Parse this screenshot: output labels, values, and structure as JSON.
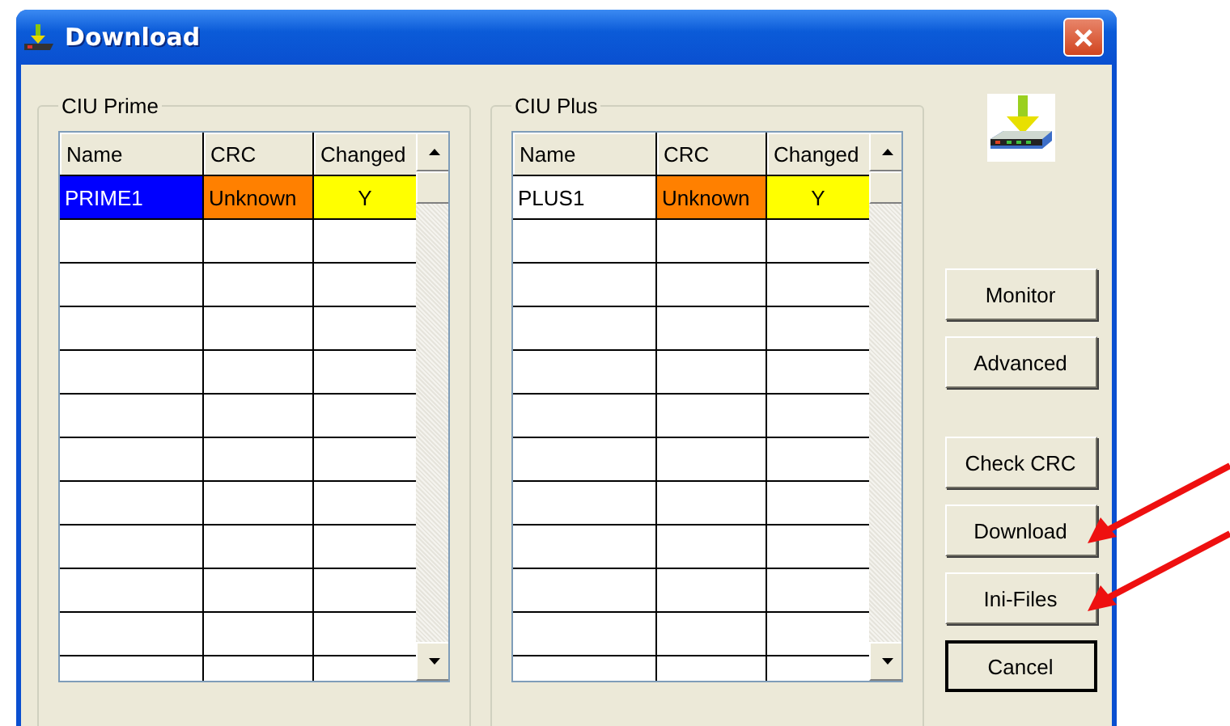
{
  "window": {
    "title": "Download"
  },
  "groups": [
    {
      "title": "CIU Prime",
      "columns": [
        "Name",
        "CRC",
        "Changed"
      ],
      "rows": [
        {
          "selected": true,
          "cells": [
            {
              "text": "PRIME1"
            },
            {
              "text": "Unknown",
              "color": "#ff8000"
            },
            {
              "text": "Y",
              "color": "#ffff00"
            }
          ]
        }
      ]
    },
    {
      "title": "CIU Plus",
      "columns": [
        "Name",
        "CRC",
        "Changed"
      ],
      "rows": [
        {
          "selected": false,
          "cells": [
            {
              "text": "PLUS1"
            },
            {
              "text": "Unknown",
              "color": "#ff8000"
            },
            {
              "text": "Y",
              "color": "#ffff00"
            }
          ]
        }
      ]
    }
  ],
  "button_groups": [
    {
      "buttons": [
        {
          "label": "Monitor",
          "default": false,
          "pointed": false
        },
        {
          "label": "Advanced",
          "default": false,
          "pointed": false
        }
      ]
    },
    {
      "buttons": [
        {
          "label": "Check CRC",
          "default": false,
          "pointed": false
        },
        {
          "label": "Download",
          "default": false,
          "pointed": true
        },
        {
          "label": "Ini-Files",
          "default": false,
          "pointed": true
        },
        {
          "label": "Cancel",
          "default": true,
          "pointed": false
        }
      ]
    }
  ]
}
